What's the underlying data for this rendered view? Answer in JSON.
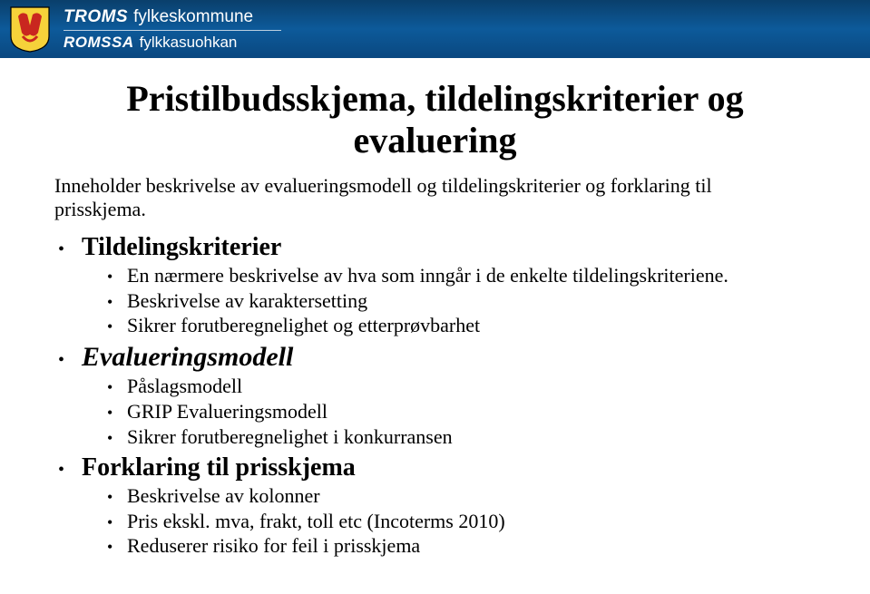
{
  "header": {
    "org_bold": "TROMS",
    "org_rest": "fylkeskommune",
    "org2_bold": "ROMSSA",
    "org2_rest": "fylkkasuohkan"
  },
  "title_line1": "Pristilbudsskjema, tildelingskriterier og",
  "title_line2": "evaluering",
  "intro_line1": "Inneholder beskrivelse av evalueringsmodell og tildelingskriterier og forklaring til",
  "intro_line2": "prisskjema.",
  "sections": {
    "s1": {
      "label": "Tildelingskriterier",
      "items": [
        "En nærmere beskrivelse av hva som inngår i de enkelte tildelingskriteriene.",
        "Beskrivelse av karaktersetting",
        "Sikrer forutberegnelighet og etterprøvbarhet"
      ]
    },
    "s2": {
      "label": "Evalueringsmodell",
      "items": [
        "Påslagsmodell",
        "GRIP Evalueringsmodell",
        "Sikrer forutberegnelighet i konkurransen"
      ]
    },
    "s3": {
      "label": "Forklaring til prisskjema",
      "items": [
        "Beskrivelse av kolonner",
        "Pris ekskl. mva, frakt, toll etc (Incoterms 2010)",
        "Reduserer risiko for feil i prisskjema"
      ]
    }
  }
}
